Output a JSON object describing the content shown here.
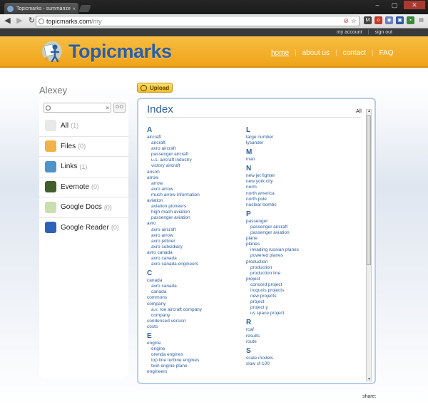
{
  "browser": {
    "tab_title": "Topicmarks - summarize yo",
    "tab_close": "×",
    "url_host": "topicmarks.com",
    "url_path": "/my",
    "window_controls": [
      "–",
      "▢",
      "✕"
    ]
  },
  "site": {
    "top_links": {
      "account": "my account",
      "separator": "|",
      "signout": "sign out"
    },
    "logo_text": "Topicmarks",
    "nav": [
      {
        "label": "home"
      },
      {
        "label": "about us"
      },
      {
        "label": "contact"
      },
      {
        "label": "FAQ"
      }
    ],
    "nav_separator": "|"
  },
  "user": {
    "name": "Alexey"
  },
  "upload": {
    "label": "Upload"
  },
  "search": {
    "clear": "×",
    "go": "GO"
  },
  "sources": [
    {
      "label": "All",
      "count": "(1)",
      "icon": "all-icon",
      "color": "#e8e8e8"
    },
    {
      "label": "Files",
      "count": "(0)",
      "icon": "folder-icon",
      "color": "#f2b24a"
    },
    {
      "label": "Links",
      "count": "(1)",
      "icon": "globe-icon",
      "color": "#4f93c9"
    },
    {
      "label": "Evernote",
      "count": "(0)",
      "icon": "evernote-icon",
      "color": "#3f5e2c"
    },
    {
      "label": "Google Docs",
      "count": "(0)",
      "icon": "google-docs-icon",
      "color": "#c9dfb0"
    },
    {
      "label": "Google Reader",
      "count": "(0)",
      "icon": "google-reader-icon",
      "color": "#2d62b8"
    }
  ],
  "index": {
    "title": "Index",
    "all_label": "All",
    "left": [
      {
        "letter": "A",
        "terms": [
          {
            "t": "aircraft",
            "l": 0
          },
          {
            "t": "aircraft",
            "l": 1
          },
          {
            "t": "avro aircraft",
            "l": 1
          },
          {
            "t": "passenger aircraft",
            "l": 1
          },
          {
            "t": "u.s. aircraft industry",
            "l": 1
          },
          {
            "t": "victory aircraft",
            "l": 1
          },
          {
            "t": "anson",
            "l": 0
          },
          {
            "t": "arrow",
            "l": 0
          },
          {
            "t": "arrow",
            "l": 1
          },
          {
            "t": "avro arrow",
            "l": 1
          },
          {
            "t": "much arrow information",
            "l": 1
          },
          {
            "t": "aviation",
            "l": 0
          },
          {
            "t": "aviation pioneers",
            "l": 1
          },
          {
            "t": "high mach aviation",
            "l": 1
          },
          {
            "t": "passenger aviation",
            "l": 1
          },
          {
            "t": "avro",
            "l": 0
          },
          {
            "t": "avro aircraft",
            "l": 1
          },
          {
            "t": "avro arrow",
            "l": 1
          },
          {
            "t": "avro jetliner",
            "l": 1
          },
          {
            "t": "avro subsidiary",
            "l": 1
          },
          {
            "t": "avro canada",
            "l": 0
          },
          {
            "t": "avro canada",
            "l": 1
          },
          {
            "t": "avro canada engineers",
            "l": 1
          }
        ]
      },
      {
        "letter": "C",
        "terms": [
          {
            "t": "canada",
            "l": 0
          },
          {
            "t": "avro canada",
            "l": 1
          },
          {
            "t": "canada",
            "l": 1
          },
          {
            "t": "commons",
            "l": 0
          },
          {
            "t": "company",
            "l": 0
          },
          {
            "t": "a.v. roe aircraft company",
            "l": 1
          },
          {
            "t": "company",
            "l": 1
          },
          {
            "t": "condensed version",
            "l": 0
          },
          {
            "t": "costs",
            "l": 0
          }
        ]
      },
      {
        "letter": "E",
        "terms": [
          {
            "t": "engine",
            "l": 0
          },
          {
            "t": "engine",
            "l": 1
          },
          {
            "t": "orenda engines",
            "l": 1
          },
          {
            "t": "top line turbine engines",
            "l": 1
          },
          {
            "t": "twin engine plane",
            "l": 1
          },
          {
            "t": "engineers",
            "l": 0
          }
        ]
      }
    ],
    "right": [
      {
        "letter": "L",
        "terms": [
          {
            "t": "large number",
            "l": 0
          },
          {
            "t": "lysander",
            "l": 0
          }
        ]
      },
      {
        "letter": "M",
        "terms": [
          {
            "t": "man",
            "l": 0
          }
        ]
      },
      {
        "letter": "N",
        "terms": [
          {
            "t": "new jet fighter",
            "l": 0
          },
          {
            "t": "new york city",
            "l": 0
          },
          {
            "t": "norm",
            "l": 0
          },
          {
            "t": "north america",
            "l": 0
          },
          {
            "t": "north pole",
            "l": 0
          },
          {
            "t": "nuclear bombs",
            "l": 0
          }
        ]
      },
      {
        "letter": "P",
        "terms": [
          {
            "t": "passenger",
            "l": 0
          },
          {
            "t": "passenger aircraft",
            "l": 1
          },
          {
            "t": "passenger aviation",
            "l": 1
          },
          {
            "t": "plane",
            "l": 0
          },
          {
            "t": "planes",
            "l": 0
          },
          {
            "t": "invading russian planes",
            "l": 1
          },
          {
            "t": "powered planes",
            "l": 1
          },
          {
            "t": "production",
            "l": 0
          },
          {
            "t": "production",
            "l": 1
          },
          {
            "t": "production line",
            "l": 1
          },
          {
            "t": "project",
            "l": 0
          },
          {
            "t": "concord project",
            "l": 1
          },
          {
            "t": "iroquois projects",
            "l": 1
          },
          {
            "t": "new projects",
            "l": 1
          },
          {
            "t": "project",
            "l": 1
          },
          {
            "t": "project y",
            "l": 1
          },
          {
            "t": "us space project",
            "l": 1
          }
        ]
      },
      {
        "letter": "R",
        "terms": [
          {
            "t": "rcaf",
            "l": 0
          },
          {
            "t": "results",
            "l": 0
          },
          {
            "t": "route",
            "l": 0
          }
        ]
      },
      {
        "letter": "S",
        "terms": [
          {
            "t": "scale models",
            "l": 0
          },
          {
            "t": "slow cf-100",
            "l": 0
          }
        ]
      }
    ]
  },
  "footer": {
    "share": "share:"
  }
}
